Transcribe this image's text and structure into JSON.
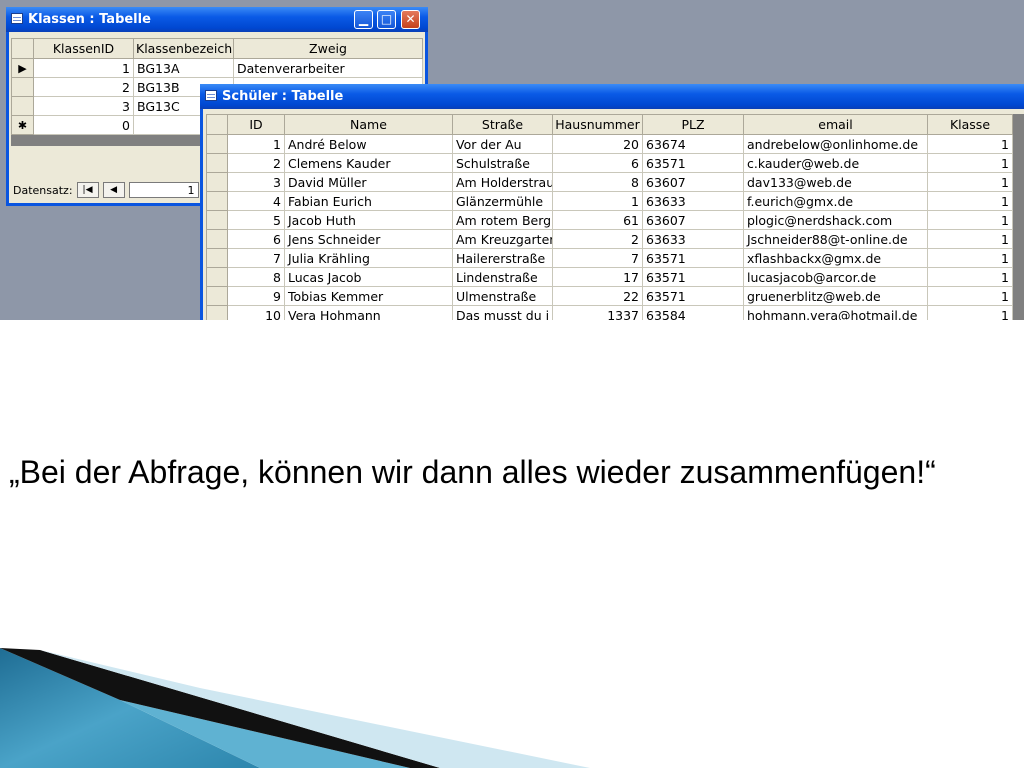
{
  "klassen_window": {
    "title": "Klassen : Tabelle",
    "columns": [
      "KlassenID",
      "Klassenbezeich",
      "Zweig"
    ],
    "rows": [
      {
        "marker": "▶",
        "id": "1",
        "bez": "BG13A",
        "zweig": "Datenverarbeiter"
      },
      {
        "marker": "",
        "id": "2",
        "bez": "BG13B",
        "zweig": ""
      },
      {
        "marker": "",
        "id": "3",
        "bez": "BG13C",
        "zweig": ""
      },
      {
        "marker": "✱",
        "id": "0",
        "bez": "",
        "zweig": ""
      }
    ],
    "record_nav": {
      "label": "Datensatz:",
      "current": "1"
    }
  },
  "schueler_window": {
    "title": "Schüler : Tabelle",
    "columns": [
      "ID",
      "Name",
      "Straße",
      "Hausnummer",
      "PLZ",
      "email",
      "Klasse"
    ],
    "rows": [
      {
        "id": "1",
        "name": "André Below",
        "strasse": "Vor der Au",
        "hausnummer": "20",
        "plz": "63674",
        "email": "andrebelow@onlinhome.de",
        "klasse": "1"
      },
      {
        "id": "2",
        "name": "Clemens Kauder",
        "strasse": "Schulstraße",
        "hausnummer": "6",
        "plz": "63571",
        "email": "c.kauder@web.de",
        "klasse": "1"
      },
      {
        "id": "3",
        "name": "David Müller",
        "strasse": "Am Holderstrau",
        "hausnummer": "8",
        "plz": "63607",
        "email": "dav133@web.de",
        "klasse": "1"
      },
      {
        "id": "4",
        "name": "Fabian Eurich",
        "strasse": "Glänzermühle",
        "hausnummer": "1",
        "plz": "63633",
        "email": "f.eurich@gmx.de",
        "klasse": "1"
      },
      {
        "id": "5",
        "name": "Jacob Huth",
        "strasse": "Am rotem Berg",
        "hausnummer": "61",
        "plz": "63607",
        "email": "plogic@nerdshack.com",
        "klasse": "1"
      },
      {
        "id": "6",
        "name": "Jens Schneider",
        "strasse": "Am Kreuzgarter",
        "hausnummer": "2",
        "plz": "63633",
        "email": "Jschneider88@t-online.de",
        "klasse": "1"
      },
      {
        "id": "7",
        "name": "Julia Krähling",
        "strasse": "Hailererstraße",
        "hausnummer": "7",
        "plz": "63571",
        "email": "xflashbackx@gmx.de",
        "klasse": "1"
      },
      {
        "id": "8",
        "name": "Lucas Jacob",
        "strasse": "Lindenstraße",
        "hausnummer": "17",
        "plz": "63571",
        "email": "lucasjacob@arcor.de",
        "klasse": "1"
      },
      {
        "id": "9",
        "name": "Tobias Kemmer",
        "strasse": "Ulmenstraße",
        "hausnummer": "22",
        "plz": "63571",
        "email": "gruenerblitz@web.de",
        "klasse": "1"
      },
      {
        "id": "10",
        "name": "Vera Hohmann",
        "strasse": "Das musst du i",
        "hausnummer": "1337",
        "plz": "63584",
        "email": "hohmann.vera@hotmail.de",
        "klasse": "1"
      }
    ]
  },
  "slide_text": "„Bei der Abfrage, können wir dann alles wieder zusammenfügen!“",
  "colors": {
    "titlebar": "#0a5ae6",
    "desktop": "#8e97a8",
    "deco_teal": "#3a93b8"
  }
}
